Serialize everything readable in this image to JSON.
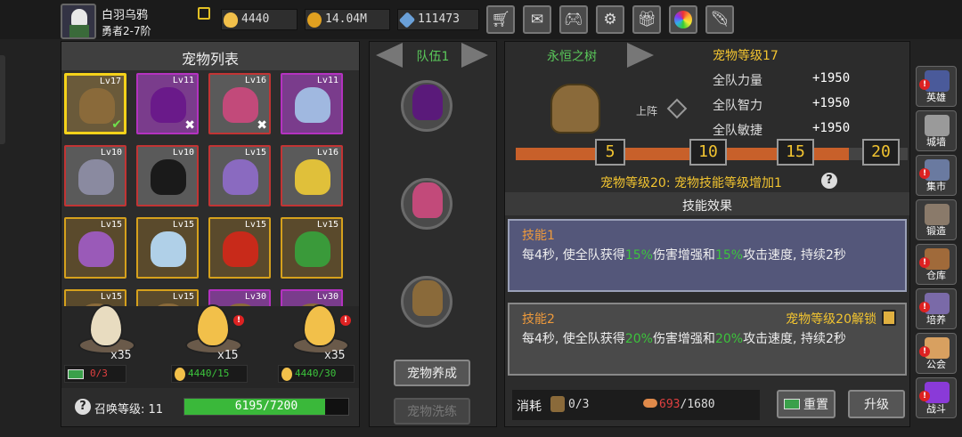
{
  "player": {
    "name": "白羽乌鸦",
    "rank": "勇者2-7阶"
  },
  "resources": {
    "eggs": "4440",
    "gold": "14.04M",
    "gems": "111473"
  },
  "toolbar": {
    "shop_icon": "cart-icon",
    "mail_icon": "mail-icon",
    "gamepad_icon": "gamepad-icon",
    "settings_icon": "gear-icon",
    "gift_icon": "gift-icon",
    "wheel_icon": "wheel-icon",
    "feather_icon": "feather-icon"
  },
  "pet_list": {
    "title": "宠物列表",
    "rows": [
      [
        {
          "lvl": "Lv17",
          "border": "sel",
          "creature": "#8a6a3a",
          "mark": "✔"
        },
        {
          "lvl": "Lv11",
          "border": "pur",
          "creature": "#6a1a8a",
          "mark": "✖"
        },
        {
          "lvl": "Lv16",
          "border": "red",
          "creature": "#c24a7a",
          "mark": "✖"
        },
        {
          "lvl": "Lv11",
          "border": "pur",
          "creature": "#a0b8e0",
          "mark": ""
        }
      ],
      [
        {
          "lvl": "Lv10",
          "border": "red",
          "creature": "#8a8aa0",
          "mark": ""
        },
        {
          "lvl": "Lv10",
          "border": "red",
          "creature": "#1a1a1a",
          "mark": ""
        },
        {
          "lvl": "Lv15",
          "border": "red",
          "creature": "#8a6ac0",
          "mark": ""
        },
        {
          "lvl": "Lv16",
          "border": "red",
          "creature": "#e0c03a",
          "mark": ""
        }
      ],
      [
        {
          "lvl": "Lv15",
          "border": "gold",
          "creature": "#9a5ab8",
          "mark": ""
        },
        {
          "lvl": "Lv15",
          "border": "gold",
          "creature": "#b0d0e8",
          "mark": ""
        },
        {
          "lvl": "Lv15",
          "border": "gold",
          "creature": "#c82a1a",
          "mark": ""
        },
        {
          "lvl": "Lv15",
          "border": "gold",
          "creature": "#3a9a3a",
          "mark": ""
        }
      ],
      [
        {
          "lvl": "Lv15",
          "border": "gold",
          "creature": "#8a6a3a",
          "mark": ""
        },
        {
          "lvl": "Lv15",
          "border": "gold",
          "creature": "#8a6a3a",
          "mark": ""
        },
        {
          "lvl": "Lv30",
          "border": "pur",
          "creature": "#8a6a3a",
          "mark": ""
        },
        {
          "lvl": "Lv30",
          "border": "pur",
          "creature": "#8a6a3a",
          "mark": ""
        }
      ]
    ]
  },
  "eggs": [
    {
      "count": "x35",
      "cost": "0/3",
      "cost_icon": "video-ad-icon",
      "color": "#e8dcc0",
      "alert": false
    },
    {
      "count": "x15",
      "cost": "4440/15",
      "cost_icon": "egg-icon",
      "color": "#f2c04a",
      "alert": true
    },
    {
      "count": "x35",
      "cost": "4440/30",
      "cost_icon": "egg-icon",
      "color": "#f2c04a",
      "alert": true
    }
  ],
  "summon": {
    "label": "召唤等级: 11",
    "progress_text": "6195/7200",
    "progress": 0.86
  },
  "team": {
    "label": "队伍1",
    "slot_colors": [
      "#5a1a7a",
      "#c24a7a",
      "#8a6a3a"
    ],
    "train_btn": "宠物养成",
    "wash_btn": "宠物洗练"
  },
  "detail": {
    "pet_name": "永恒之树",
    "pet_level": "宠物等级17",
    "deploy": "上阵",
    "stats": [
      {
        "label": "全队力量",
        "value": "+1950"
      },
      {
        "label": "全队智力",
        "value": "+1950"
      },
      {
        "label": "全队敏捷",
        "value": "+1950"
      }
    ],
    "milestones": [
      "5",
      "10",
      "15",
      "20"
    ],
    "progress": 0.85,
    "bonus_text": "宠物等级20: 宠物技能等级增加1",
    "skill_title": "技能效果",
    "skills": [
      {
        "name": "技能1",
        "pre": "每4秒, 使全队获得",
        "v1": "15%",
        "mid": "伤害增强和",
        "v2": "15%",
        "post": "攻击速度, 持续2秒",
        "lock": ""
      },
      {
        "name": "技能2",
        "pre": "每4秒, 使全队获得",
        "v1": "20%",
        "mid": "伤害增强和",
        "v2": "20%",
        "post": "攻击速度, 持续2秒",
        "lock": "宠物等级20解锁"
      }
    ],
    "cost_label": "消耗",
    "cost1": "0/3",
    "cost2_have": "693",
    "cost2_need": "/1680",
    "reset_btn": "重置",
    "upgrade_btn": "升级"
  },
  "side_menu": [
    {
      "label": "英雄",
      "color": "#4a5a9a",
      "alert": true
    },
    {
      "label": "城墙",
      "color": "#9a9a9a",
      "alert": false
    },
    {
      "label": "集市",
      "color": "#6a7aa0",
      "alert": true
    },
    {
      "label": "锻造",
      "color": "#8a7a6a",
      "alert": false
    },
    {
      "label": "仓库",
      "color": "#a06a3a",
      "alert": true
    },
    {
      "label": "培养",
      "color": "#7a6aa8",
      "alert": true
    },
    {
      "label": "公会",
      "color": "#d8a060",
      "alert": true
    },
    {
      "label": "战斗",
      "color": "#8a3ad8",
      "alert": true
    }
  ],
  "colors": {
    "accent": "#f2c430",
    "skill_value": "#3cc43c",
    "skill_name": "#ee9a3c",
    "progress": "#c8602a",
    "summon_bar": "#3ab83a"
  }
}
